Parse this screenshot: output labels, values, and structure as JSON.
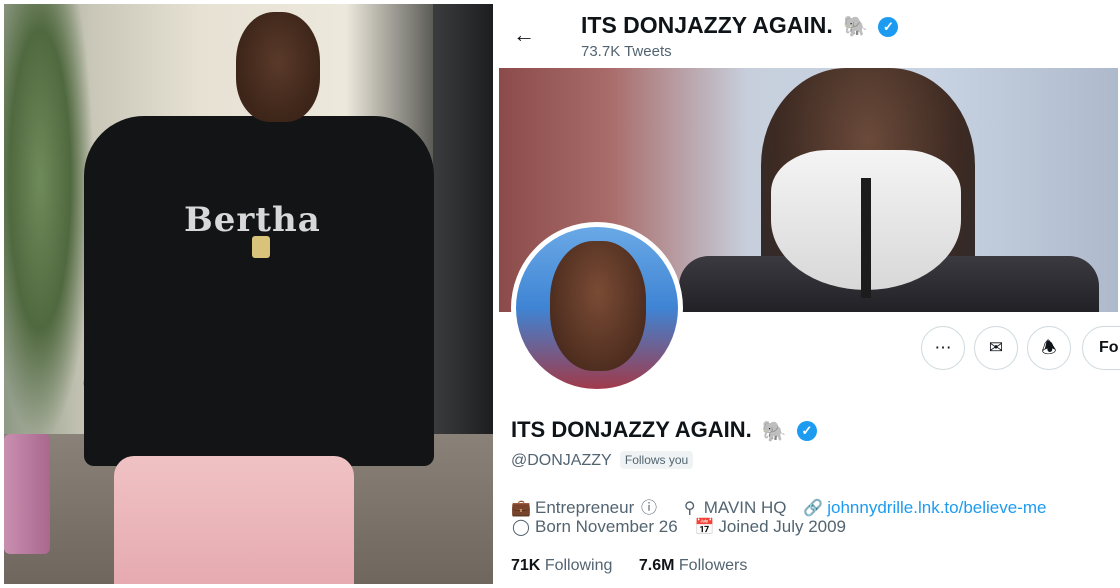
{
  "header": {
    "display_name": "ITS DONJAZZY AGAIN.",
    "tweet_count": "73.7K Tweets",
    "name_emoji": "🐘"
  },
  "profile": {
    "display_name": "ITS DONJAZZY AGAIN.",
    "name_emoji": "🐘",
    "handle": "@DONJAZZY",
    "follows_you_badge": "Follows you",
    "profession": "Entrepreneur",
    "location": "MAVIN HQ",
    "website": "johnnydrille.lnk.to/believe-me",
    "birthday": "Born November 26",
    "joined": "Joined July 2009",
    "following_count": "71K",
    "following_label": "Following",
    "followers_count": "7.6M",
    "followers_label": "Followers"
  },
  "photo": {
    "shirt_text": "Bertha"
  },
  "actions": {
    "more_icon": "more-icon",
    "message_icon": "mail-icon",
    "notify_icon": "bell-plus-icon",
    "follow_label_partial": "Fo"
  },
  "icons": {
    "back": "arrow-left-icon",
    "verified": "verified-badge-icon",
    "profession": "briefcase-icon",
    "info": "info-icon",
    "location": "location-pin-icon",
    "website": "link-icon",
    "birthday": "balloon-icon",
    "joined": "calendar-icon"
  },
  "colors": {
    "accent": "#1d9bf0",
    "text_primary": "#0f1419",
    "text_secondary": "#536471",
    "border": "#cfd9de"
  }
}
